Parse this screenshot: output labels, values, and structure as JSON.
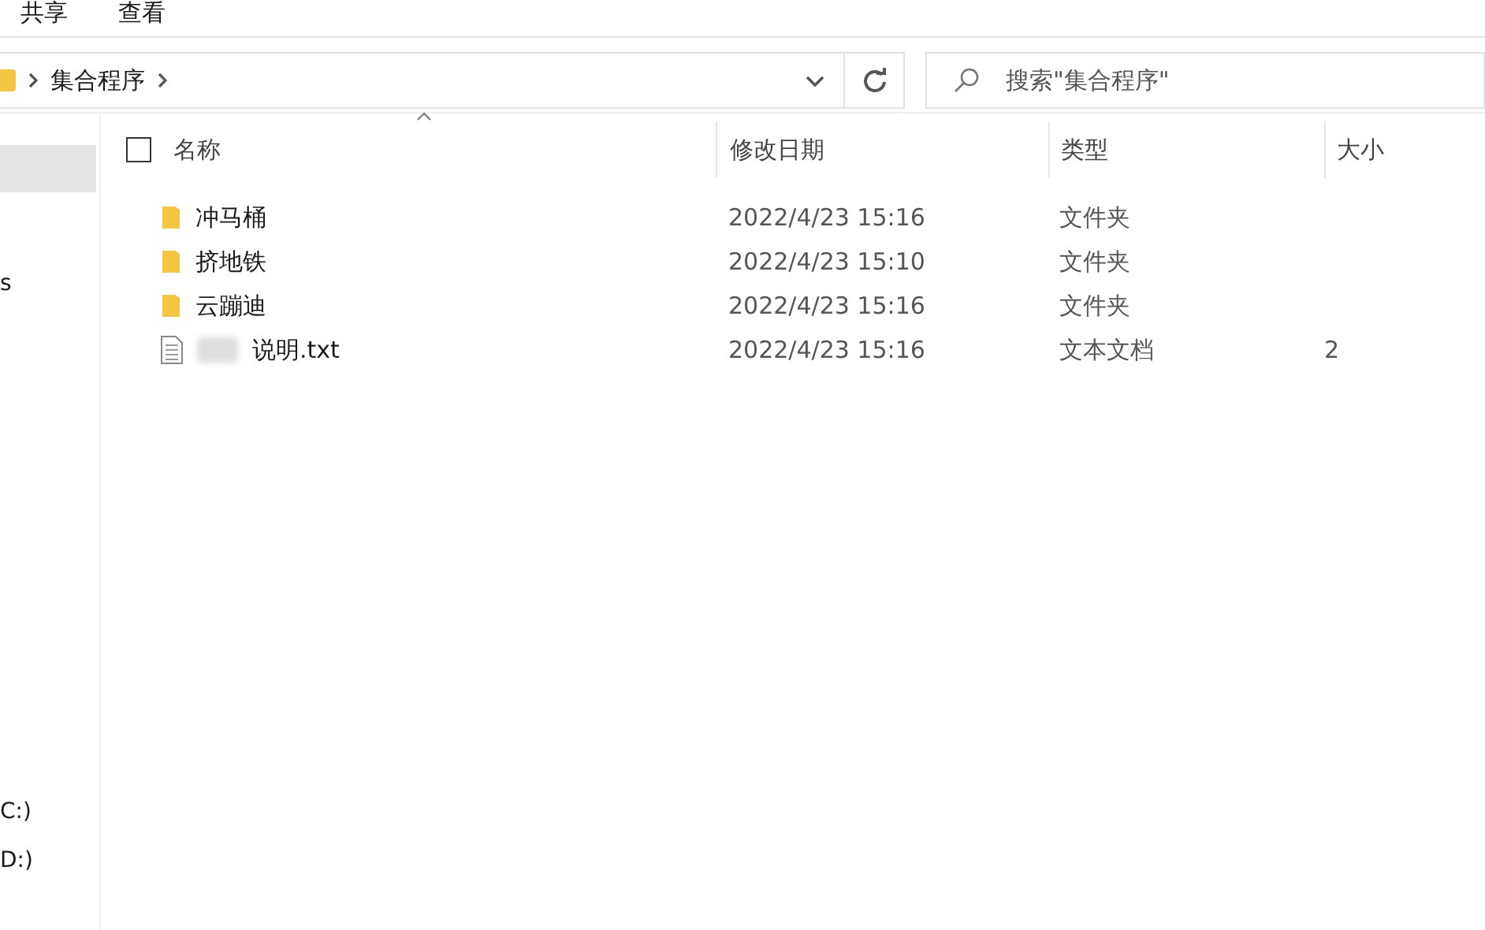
{
  "ribbon_tabs": [
    {
      "label": "共享",
      "selected": false
    },
    {
      "label": "查看",
      "selected": false
    }
  ],
  "address_bar": {
    "path": [
      "集合程序"
    ]
  },
  "search": {
    "placeholder": "搜索\"集合程序\""
  },
  "sidebar": {
    "items": [
      {
        "selected": true
      },
      {
        "label": "s",
        "selected": false
      },
      {
        "label": "C:)",
        "selected": false
      },
      {
        "label": "D:)",
        "selected": false
      }
    ]
  },
  "table": {
    "select_all_checked": false,
    "columns": [
      "名称",
      "修改日期",
      "类型",
      "大小"
    ],
    "rows": [
      {
        "kind": "folder",
        "name": "冲马桶",
        "modified": "2022/4/23 15:16",
        "type": "文件夹"
      },
      {
        "kind": "folder",
        "name": "挤地铁",
        "modified": "2022/4/23 15:10",
        "type": "文件夹"
      },
      {
        "kind": "folder",
        "name": "云蹦迪",
        "modified": "2022/4/23 15:16",
        "type": "文件夹"
      },
      {
        "kind": "text",
        "name": "说明.txt",
        "redacted": true,
        "modified": "2022/4/23 15:16",
        "type": "文本文档",
        "size": "2"
      }
    ]
  }
}
